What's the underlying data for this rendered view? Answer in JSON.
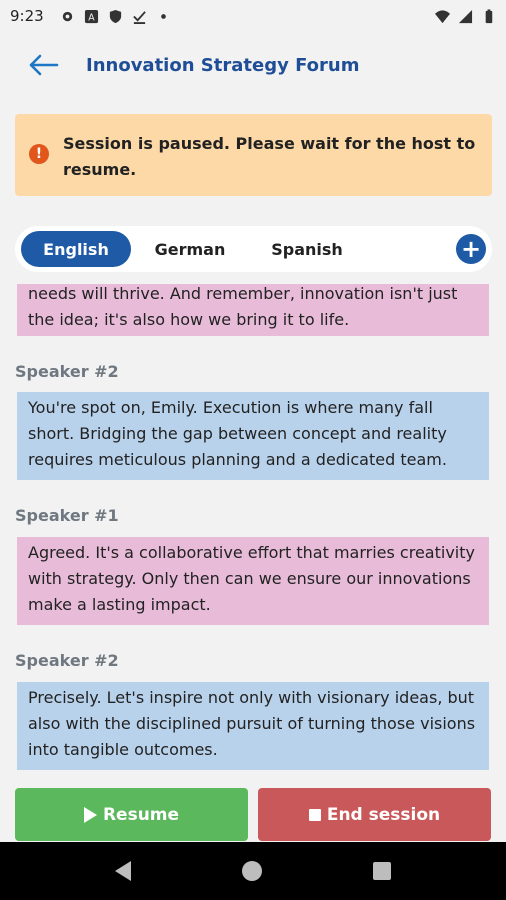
{
  "status_bar": {
    "time": "9:23",
    "icons": [
      "settings-icon",
      "a-notification-icon",
      "shield-icon",
      "download-done-icon",
      "dot-icon",
      "wifi-icon",
      "signal-icon",
      "battery-icon"
    ]
  },
  "app_bar": {
    "title": "Innovation Strategy Forum",
    "back_icon": "arrow-left-icon",
    "accent": "#1f4e96"
  },
  "banner": {
    "message": "Session is paused. Please wait for the host to resume.",
    "icon": "alert-icon",
    "background": "#fdd9a8"
  },
  "languages": {
    "tabs": [
      {
        "label": "English",
        "active": true
      },
      {
        "label": "German",
        "active": false
      },
      {
        "label": "Spanish",
        "active": false
      }
    ],
    "add_icon": "plus-circle-icon"
  },
  "transcript": {
    "entries": [
      {
        "speaker": "",
        "lines": [
          "needs will thrive. And remember, innovation isn't just",
          "the idea; it's also how we bring it to life."
        ]
      },
      {
        "speaker": "Speaker #2",
        "lines": [
          "You're spot on, Emily. Execution is where many fall",
          "short. Bridging the gap between concept and reality",
          "requires meticulous planning and a dedicated team."
        ]
      },
      {
        "speaker": "Speaker #1",
        "lines": [
          "Agreed. It's a collaborative effort that marries creativity",
          "with strategy. Only then can we ensure our innovations",
          "make a lasting impact."
        ]
      },
      {
        "speaker": "Speaker #2",
        "lines": [
          "Precisely. Let's inspire not only with visionary ideas, but",
          "also with the disciplined pursuit of turning those visions",
          "into tangible outcomes."
        ]
      }
    ],
    "speaker1_color": "#e8bcd9",
    "speaker2_color": "#b9d2ec"
  },
  "actions": {
    "resume_label": "Resume",
    "end_label": "End session",
    "resume_color": "#5cb85c",
    "end_color": "#c9585a"
  }
}
